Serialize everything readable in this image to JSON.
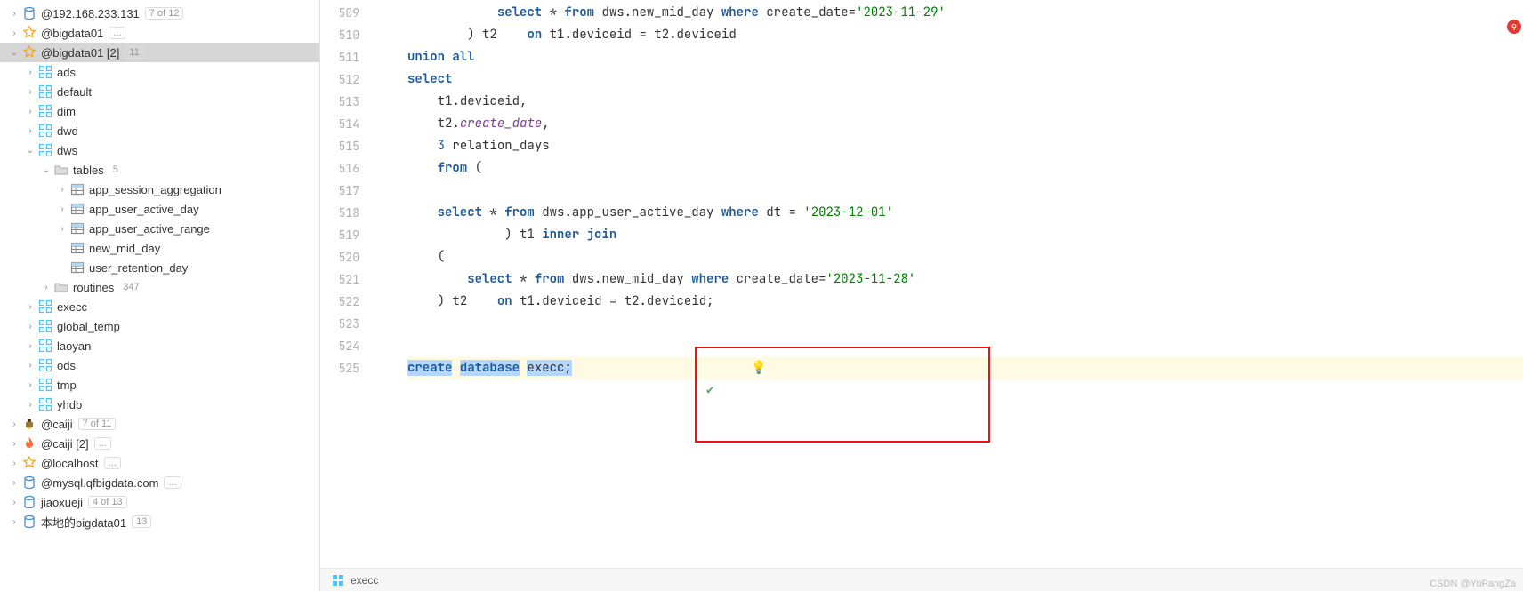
{
  "sidebar": {
    "items": [
      {
        "indent": 0,
        "expand": "closed",
        "icon": "db-blue",
        "label": "@192.168.233.131",
        "badge": "7 of 12"
      },
      {
        "indent": 0,
        "expand": "closed",
        "icon": "star",
        "label": "@bigdata01",
        "badge": "..."
      },
      {
        "indent": 0,
        "expand": "open",
        "icon": "star",
        "label": "@bigdata01 [2]",
        "badge": "11",
        "selected": true
      },
      {
        "indent": 1,
        "expand": "closed",
        "icon": "schema",
        "label": "ads"
      },
      {
        "indent": 1,
        "expand": "closed",
        "icon": "schema",
        "label": "default"
      },
      {
        "indent": 1,
        "expand": "closed",
        "icon": "schema",
        "label": "dim"
      },
      {
        "indent": 1,
        "expand": "closed",
        "icon": "schema",
        "label": "dwd"
      },
      {
        "indent": 1,
        "expand": "open",
        "icon": "schema",
        "label": "dws"
      },
      {
        "indent": 2,
        "expand": "open",
        "icon": "folder",
        "label": "tables",
        "badge": "5",
        "nobox": true
      },
      {
        "indent": 3,
        "expand": "closed",
        "icon": "table",
        "label": "app_session_aggregation"
      },
      {
        "indent": 3,
        "expand": "closed",
        "icon": "table",
        "label": "app_user_active_day"
      },
      {
        "indent": 3,
        "expand": "closed",
        "icon": "table",
        "label": "app_user_active_range"
      },
      {
        "indent": 3,
        "expand": "none",
        "icon": "table",
        "label": "new_mid_day"
      },
      {
        "indent": 3,
        "expand": "none",
        "icon": "table",
        "label": "user_retention_day"
      },
      {
        "indent": 2,
        "expand": "closed",
        "icon": "folder",
        "label": "routines",
        "badge": "347",
        "nobox": true
      },
      {
        "indent": 1,
        "expand": "closed",
        "icon": "schema",
        "label": "execc"
      },
      {
        "indent": 1,
        "expand": "closed",
        "icon": "schema",
        "label": "global_temp"
      },
      {
        "indent": 1,
        "expand": "closed",
        "icon": "schema",
        "label": "laoyan"
      },
      {
        "indent": 1,
        "expand": "closed",
        "icon": "schema",
        "label": "ods"
      },
      {
        "indent": 1,
        "expand": "closed",
        "icon": "schema",
        "label": "tmp"
      },
      {
        "indent": 1,
        "expand": "closed",
        "icon": "schema",
        "label": "yhdb"
      },
      {
        "indent": 0,
        "expand": "closed",
        "icon": "bee",
        "label": "@caiji",
        "badge": "7 of 11"
      },
      {
        "indent": 0,
        "expand": "closed",
        "icon": "flame",
        "label": "@caiji [2]",
        "badge": "..."
      },
      {
        "indent": 0,
        "expand": "closed",
        "icon": "star",
        "label": "@localhost",
        "badge": "..."
      },
      {
        "indent": 0,
        "expand": "closed",
        "icon": "db-blue",
        "label": "@mysql.qfbigdata.com",
        "badge": "..."
      },
      {
        "indent": 0,
        "expand": "closed",
        "icon": "db-blue",
        "label": "jiaoxueji",
        "badge": "4 of 13"
      },
      {
        "indent": 0,
        "expand": "closed",
        "icon": "db-blue",
        "label": "本地的bigdata01",
        "badge": "13"
      }
    ]
  },
  "editor": {
    "startLine": 509,
    "lines": [
      {
        "n": 509,
        "t": [
          [
            "",
            "            "
          ],
          [
            "kw",
            "select"
          ],
          [
            "",
            " * "
          ],
          [
            "kw",
            "from"
          ],
          [
            "",
            " "
          ],
          [
            "id",
            "dws"
          ],
          [
            "op",
            "."
          ],
          [
            "id",
            "new_mid_day"
          ],
          [
            "",
            " "
          ],
          [
            "kw",
            "where"
          ],
          [
            "",
            " "
          ],
          [
            "id",
            "create_date"
          ],
          [
            "op",
            "="
          ],
          [
            "str",
            "'2023-11-29'"
          ]
        ]
      },
      {
        "n": 510,
        "t": [
          [
            "",
            "        "
          ],
          [
            "op",
            ")"
          ],
          [
            "",
            " "
          ],
          [
            "id",
            "t2"
          ],
          [
            "",
            "    "
          ],
          [
            "kw",
            "on"
          ],
          [
            "",
            " "
          ],
          [
            "id",
            "t1"
          ],
          [
            "op",
            "."
          ],
          [
            "id",
            "deviceid"
          ],
          [
            "",
            " "
          ],
          [
            "op",
            "="
          ],
          [
            "",
            " "
          ],
          [
            "id",
            "t2"
          ],
          [
            "op",
            "."
          ],
          [
            "id",
            "deviceid"
          ]
        ]
      },
      {
        "n": 511,
        "t": [
          [
            "kw",
            "union"
          ],
          [
            "",
            " "
          ],
          [
            "kw",
            "all"
          ]
        ]
      },
      {
        "n": 512,
        "t": [
          [
            "kw",
            "select"
          ]
        ]
      },
      {
        "n": 513,
        "t": [
          [
            "",
            "    "
          ],
          [
            "id",
            "t1"
          ],
          [
            "op",
            "."
          ],
          [
            "id",
            "deviceid"
          ],
          [
            "op",
            ","
          ]
        ]
      },
      {
        "n": 514,
        "t": [
          [
            "",
            "    "
          ],
          [
            "id",
            "t2"
          ],
          [
            "op",
            "."
          ],
          [
            "fn",
            "create_date"
          ],
          [
            "op",
            ","
          ]
        ]
      },
      {
        "n": 515,
        "t": [
          [
            "",
            "    "
          ],
          [
            "num",
            "3"
          ],
          [
            "",
            " "
          ],
          [
            "id",
            "relation_days"
          ]
        ]
      },
      {
        "n": 516,
        "t": [
          [
            "",
            "    "
          ],
          [
            "kw",
            "from"
          ],
          [
            "",
            " "
          ],
          [
            "op",
            "("
          ]
        ]
      },
      {
        "n": 517,
        "t": [
          [
            "",
            ""
          ]
        ]
      },
      {
        "n": 518,
        "t": [
          [
            "",
            "    "
          ],
          [
            "kw",
            "select"
          ],
          [
            "",
            " * "
          ],
          [
            "kw",
            "from"
          ],
          [
            "",
            " "
          ],
          [
            "id",
            "dws"
          ],
          [
            "op",
            "."
          ],
          [
            "id",
            "app_user_active_day"
          ],
          [
            "",
            " "
          ],
          [
            "kw",
            "where"
          ],
          [
            "",
            " "
          ],
          [
            "id",
            "dt"
          ],
          [
            "",
            " "
          ],
          [
            "op",
            "="
          ],
          [
            "",
            " "
          ],
          [
            "str",
            "'2023-12-01'"
          ]
        ]
      },
      {
        "n": 519,
        "t": [
          [
            "",
            "             "
          ],
          [
            "op",
            ")"
          ],
          [
            "",
            " "
          ],
          [
            "id",
            "t1"
          ],
          [
            "",
            " "
          ],
          [
            "kw",
            "inner"
          ],
          [
            "",
            " "
          ],
          [
            "kw",
            "join"
          ]
        ]
      },
      {
        "n": 520,
        "t": [
          [
            "",
            "    "
          ],
          [
            "op",
            "("
          ]
        ]
      },
      {
        "n": 521,
        "t": [
          [
            "",
            "        "
          ],
          [
            "kw",
            "select"
          ],
          [
            "",
            " * "
          ],
          [
            "kw",
            "from"
          ],
          [
            "",
            " "
          ],
          [
            "id",
            "dws"
          ],
          [
            "op",
            "."
          ],
          [
            "id",
            "new_mid_day"
          ],
          [
            "",
            " "
          ],
          [
            "kw",
            "where"
          ],
          [
            "",
            " "
          ],
          [
            "id",
            "create_date"
          ],
          [
            "op",
            "="
          ],
          [
            "str",
            "'2023-11-28'"
          ]
        ]
      },
      {
        "n": 522,
        "t": [
          [
            "",
            "    "
          ],
          [
            "op",
            ")"
          ],
          [
            "",
            " "
          ],
          [
            "id",
            "t2"
          ],
          [
            "",
            "    "
          ],
          [
            "kw",
            "on"
          ],
          [
            "",
            " "
          ],
          [
            "id",
            "t1"
          ],
          [
            "op",
            "."
          ],
          [
            "id",
            "deviceid"
          ],
          [
            "",
            " "
          ],
          [
            "op",
            "="
          ],
          [
            "",
            " "
          ],
          [
            "id",
            "t2"
          ],
          [
            "op",
            "."
          ],
          [
            "id",
            "deviceid"
          ],
          [
            "op",
            ";"
          ]
        ]
      },
      {
        "n": 523,
        "t": [
          [
            "",
            ""
          ]
        ]
      },
      {
        "n": 524,
        "t": [
          [
            "",
            ""
          ]
        ]
      },
      {
        "n": 525,
        "hl": true,
        "sel": true,
        "t": [
          [
            "kw",
            "create"
          ],
          [
            "",
            " "
          ],
          [
            "kw",
            "database"
          ],
          [
            "",
            " "
          ],
          [
            "id",
            "execc"
          ],
          [
            "op",
            ";"
          ]
        ]
      }
    ]
  },
  "statusbar": {
    "schema": "execc"
  },
  "error_count": "9",
  "watermark": "CSDN @YuPangZa"
}
